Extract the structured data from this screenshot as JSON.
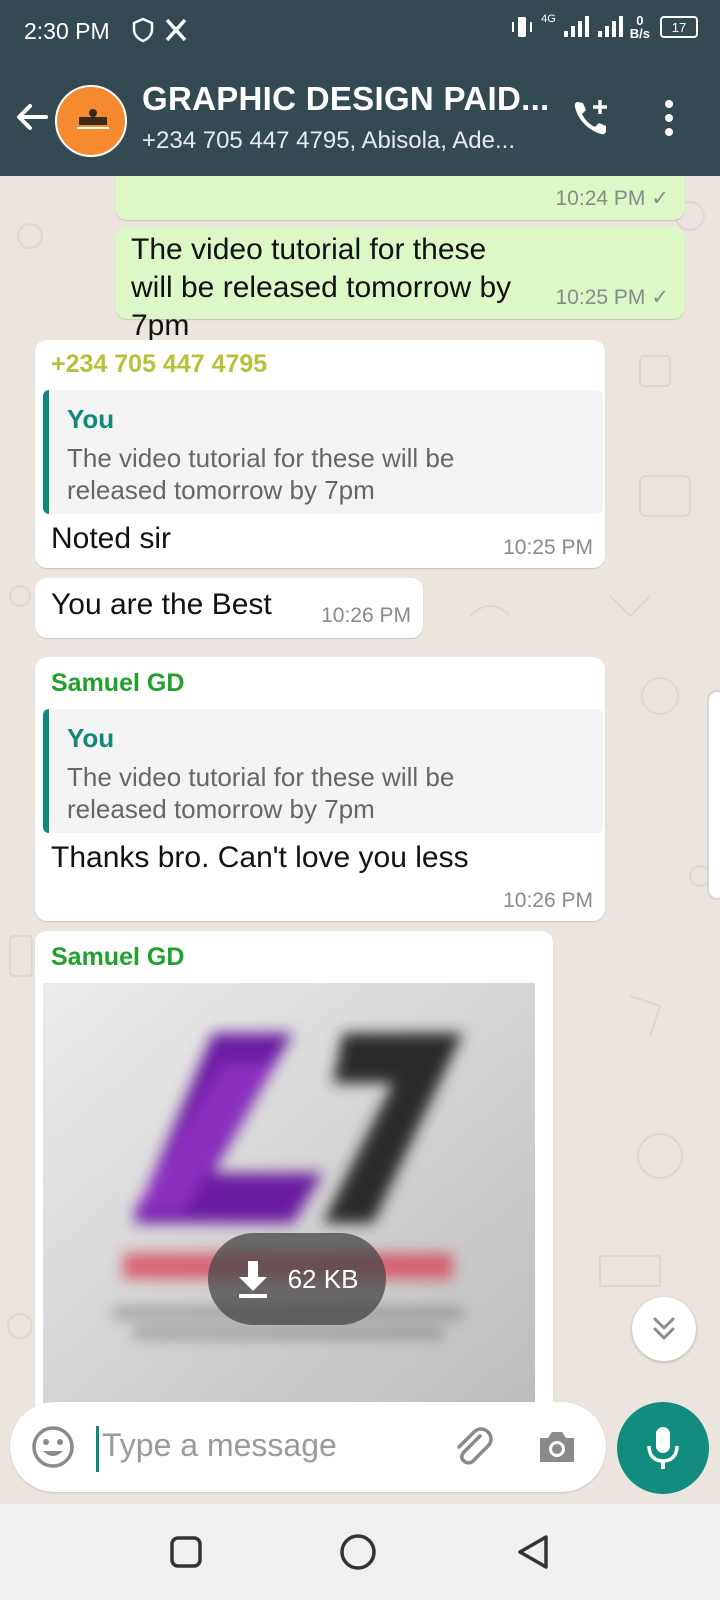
{
  "status_bar": {
    "time": "2:30 PM",
    "network": "4G",
    "speed_value": "0",
    "speed_unit": "B/s",
    "battery": "17"
  },
  "header": {
    "title": "GRAPHIC DESIGN PAID...",
    "subtitle": "+234 705 447 4795, Abisola, Ade..."
  },
  "messages": [
    {
      "type": "out",
      "time": "10:24 PM"
    },
    {
      "type": "out",
      "text": "The video tutorial for these will be released tomorrow by 7pm",
      "time": "10:25 PM"
    },
    {
      "type": "in",
      "sender": "+234 705 447 4795",
      "quote_name": "You",
      "quote_text": "The video tutorial for these will be released tomorrow by 7pm",
      "text": "Noted sir",
      "time": "10:25 PM"
    },
    {
      "type": "in",
      "text": "You are the Best",
      "time": "10:26 PM"
    },
    {
      "type": "in",
      "sender": "Samuel GD",
      "quote_name": "You",
      "quote_text": "The video tutorial for these will be released tomorrow by 7pm",
      "text": "Thanks bro. Can't love you less",
      "time": "10:26 PM"
    },
    {
      "type": "in",
      "sender": "Samuel GD",
      "image_download_size": "62 KB"
    }
  ],
  "composer": {
    "placeholder": "Type a message"
  },
  "colors": {
    "header_bg": "#344a52",
    "outgoing_bubble": "#dcf8c6",
    "incoming_bubble": "#ffffff",
    "accent": "#128c7e",
    "sender_1": "#b5c23a",
    "sender_2": "#1fa12b"
  },
  "icons": [
    "back-arrow-icon",
    "avatar",
    "call-add-icon",
    "more-vert-icon",
    "check-icon",
    "download-icon",
    "double-chevron-down-icon",
    "emoji-icon",
    "attach-icon",
    "camera-icon",
    "mic-icon",
    "nav-recents-icon",
    "nav-home-icon",
    "nav-back-icon"
  ]
}
